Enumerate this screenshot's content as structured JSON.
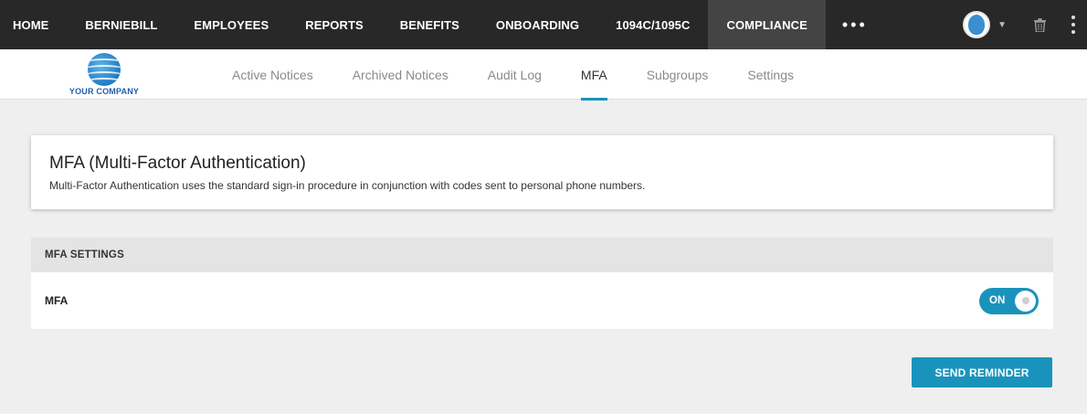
{
  "topnav": {
    "items": [
      {
        "label": "HOME"
      },
      {
        "label": "BERNIEBILL"
      },
      {
        "label": "EMPLOYEES"
      },
      {
        "label": "REPORTS"
      },
      {
        "label": "BENEFITS"
      },
      {
        "label": "ONBOARDING"
      },
      {
        "label": "1094C/1095C"
      },
      {
        "label": "COMPLIANCE",
        "active": true
      }
    ],
    "more_label": "•••"
  },
  "brand": {
    "logo_text": "YOUR COMPANY",
    "accent_color": "#1a93bc"
  },
  "subtabs": [
    {
      "label": "Active Notices"
    },
    {
      "label": "Archived Notices"
    },
    {
      "label": "Audit Log"
    },
    {
      "label": "MFA",
      "active": true
    },
    {
      "label": "Subgroups"
    },
    {
      "label": "Settings"
    }
  ],
  "card": {
    "title": "MFA (Multi-Factor Authentication)",
    "description": "Multi-Factor Authentication uses the standard sign-in procedure in conjunction with codes sent to personal phone numbers."
  },
  "settings": {
    "header": "MFA SETTINGS",
    "rows": [
      {
        "label": "MFA",
        "toggle_label": "ON",
        "enabled": true
      }
    ]
  },
  "actions": {
    "send_reminder_label": "SEND REMINDER"
  },
  "icons": {
    "user_menu": "avatar-icon",
    "dropdown": "chevron-down-icon",
    "trash": "trash-icon",
    "more": "kebab-icon"
  }
}
